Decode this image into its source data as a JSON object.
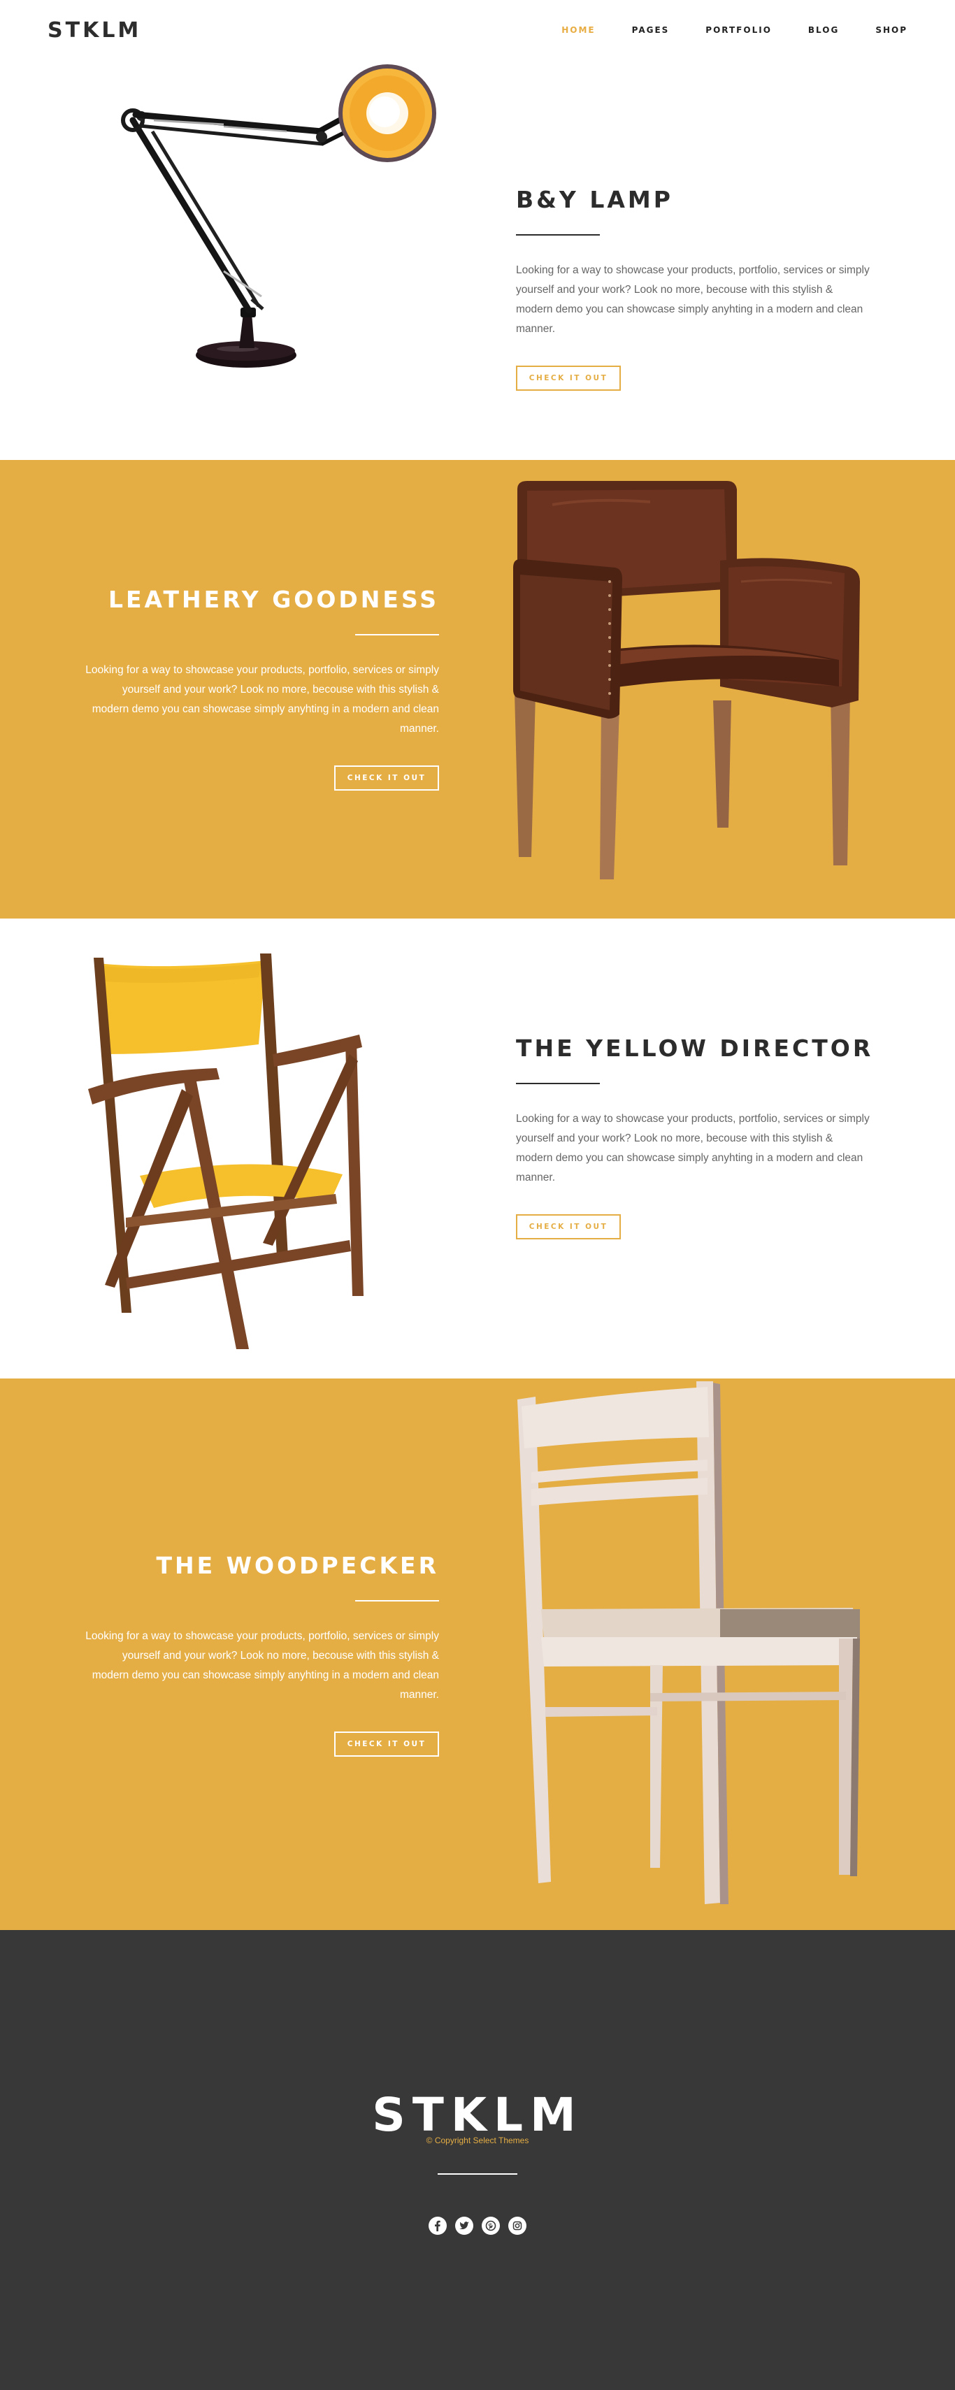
{
  "header": {
    "logo": "STKLM",
    "nav": [
      "HOME",
      "PAGES",
      "PORTFOLIO",
      "BLOG",
      "SHOP"
    ],
    "active_nav": "HOME"
  },
  "products": [
    {
      "title": "B&Y LAMP",
      "description": "Looking for a way to showcase your products, portfolio, services or simply yourself and your work? Look no more, becouse with this stylish & modern demo you can showcase simply anyhting in a modern and clean manner.",
      "button": "CHECK IT OUT",
      "image_icon": "lamp-illustration"
    },
    {
      "title": "LEATHERY GOODNESS",
      "description": "Looking for a way to showcase your products, portfolio, services or simply yourself and your work? Look no more, becouse with this stylish & modern demo you can showcase simply anyhting in a modern and clean manner.",
      "button": "CHECK IT OUT",
      "image_icon": "leather-armchair-illustration"
    },
    {
      "title": "THE YELLOW DIRECTOR",
      "description": "Looking for a way to showcase your products, portfolio, services or simply yourself and your work? Look no more, becouse with this stylish & modern demo you can showcase simply anyhting in a modern and clean manner.",
      "button": "CHECK IT OUT",
      "image_icon": "director-chair-illustration"
    },
    {
      "title": "THE WOODPECKER",
      "description": "Looking for a way to showcase your products, portfolio, services or simply yourself and your work? Look no more, becouse with this stylish & modern demo you can showcase simply anyhting in a modern and clean manner.",
      "button": "CHECK IT OUT",
      "image_icon": "wooden-chair-illustration"
    }
  ],
  "footer": {
    "logo": "STKLM",
    "copyright": "© Copyright Select Themes",
    "socials": [
      "facebook-icon",
      "twitter-icon",
      "pinterest-icon",
      "instagram-icon"
    ]
  },
  "colors": {
    "accent": "#e5ae45",
    "dark": "#383838",
    "text": "#2c2c2c"
  }
}
